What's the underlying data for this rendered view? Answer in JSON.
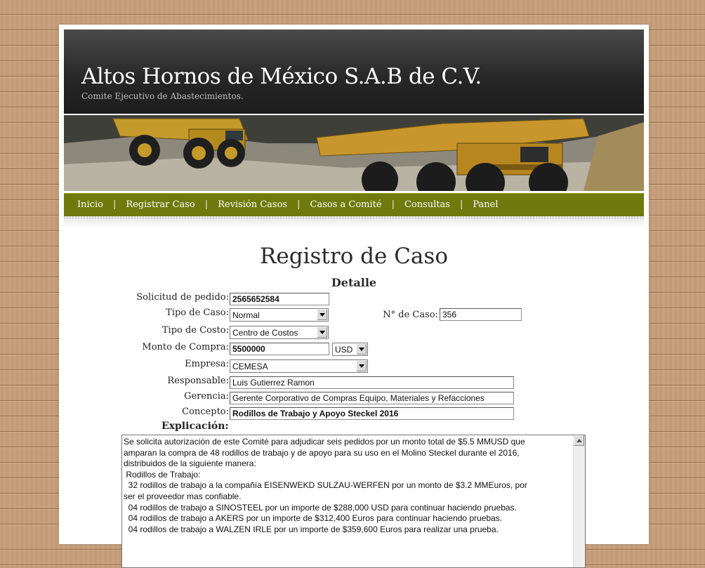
{
  "header": {
    "title": "Altos Hornos de México S.A.B de C.V.",
    "subtitle": "Comite Ejecutivo de Abastecimientos."
  },
  "nav": {
    "items": [
      "Inicio",
      "Registrar Caso",
      "Revisión Casos",
      "Casos a Comité",
      "Consultas",
      "Panel"
    ],
    "separator": "|"
  },
  "page": {
    "title": "Registro de Caso",
    "section": "Detalle"
  },
  "form": {
    "solicitud": {
      "label": "Solicitud de pedido:",
      "value": "2565652584"
    },
    "tipo_caso": {
      "label": "Tipo de Caso:",
      "value": "Normal"
    },
    "num_caso": {
      "label": "N° de Caso:",
      "value": "356"
    },
    "tipo_costo": {
      "label": "Tipo de Costo:",
      "value": "Centro de Costos"
    },
    "monto": {
      "label": "Monto de Compra:",
      "value": "5500000",
      "currency": "USD"
    },
    "empresa": {
      "label": "Empresa:",
      "value": "CEMESA"
    },
    "responsable": {
      "label": "Responsable:",
      "value": "Luis Gutierrez Ramon"
    },
    "gerencia": {
      "label": "Gerencia:",
      "value": "Gerente Corporativo de Compras Equipo, Materiales y Refacciones"
    },
    "concepto": {
      "label": "Concepto:",
      "value": "Rodillos de Trabajo y Apoyo Steckel 2016"
    },
    "explicacion": {
      "label": "Explicación:",
      "lines": [
        "Se solicita autorización de este Comité para adjudicar seis pedidos por un monto total de $5.5 MMUSD que",
        "amparan la compra de 48 rodillos de trabajo y de apoyo para su uso en el Molino Steckel durante el 2016,",
        "distribuidos de la siguiente manera:",
        " Rodillos de Trabajo:",
        "  32 rodillos de trabajo a la compañía EISENWEKD SULZAU-WERFEN por un monto de $3.2 MMEuros, por",
        "ser el proveedor mas confiable.",
        "  04 rodillos de trabajo a SINOSTEEL por un importe de $288,000 USD para continuar haciendo pruebas.",
        "  04 rodillos de trabajo a AKERS por un importe de $312,400 Euros para continuar haciendo pruebas.",
        "  04 rodillos de trabajo a WALZEN IRLE por un importe de $359,600 Euros para realizar una prueba."
      ]
    }
  },
  "colors": {
    "nav_bg": "#6e7a0c",
    "header_bg": "#262626"
  }
}
